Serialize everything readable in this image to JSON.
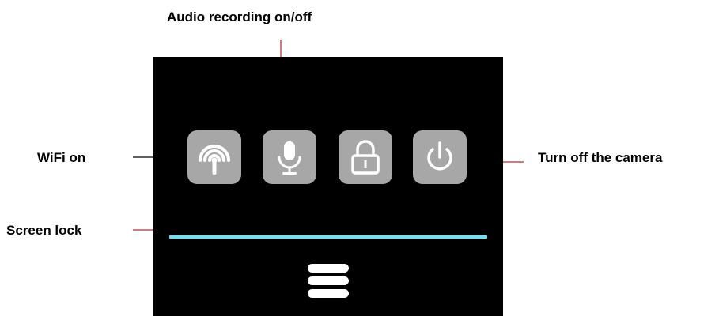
{
  "callouts": {
    "audio": "Audio recording on/off",
    "wifi": "WiFi on",
    "power": "Turn off the camera",
    "lock": "Screen lock"
  },
  "icons": {
    "wifi": "wifi-icon",
    "microphone": "microphone-icon",
    "lock": "lock-icon",
    "power": "power-icon",
    "menu": "hamburger-menu-icon"
  },
  "colors": {
    "screen_background": "#000000",
    "icon_tile": "#a7a7a7",
    "divider": "#6ee0ef",
    "callout_line_red": "#c0504d",
    "callout_line_dark": "#000000"
  }
}
